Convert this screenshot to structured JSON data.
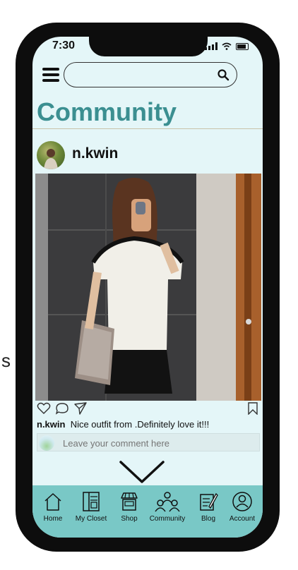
{
  "stray_text": "s",
  "status_bar": {
    "time": "7:30"
  },
  "search": {
    "placeholder": ""
  },
  "page": {
    "title": "Community"
  },
  "post": {
    "username": "n.kwin",
    "caption_user": "n.kwin",
    "caption_text": "Nice outfit from .Definitely love it!!!",
    "comment_placeholder": "Leave your comment here"
  },
  "nav": [
    {
      "label": "Home",
      "icon": "home-icon"
    },
    {
      "label": "My Closet",
      "icon": "closet-icon"
    },
    {
      "label": "Shop",
      "icon": "shop-icon"
    },
    {
      "label": "Community",
      "icon": "community-icon"
    },
    {
      "label": "Blog",
      "icon": "blog-icon"
    },
    {
      "label": "Account",
      "icon": "account-icon"
    }
  ],
  "colors": {
    "accent": "#3b8f91",
    "nav_bg": "#79c8c6",
    "screen_bg": "#e4f6f8"
  }
}
